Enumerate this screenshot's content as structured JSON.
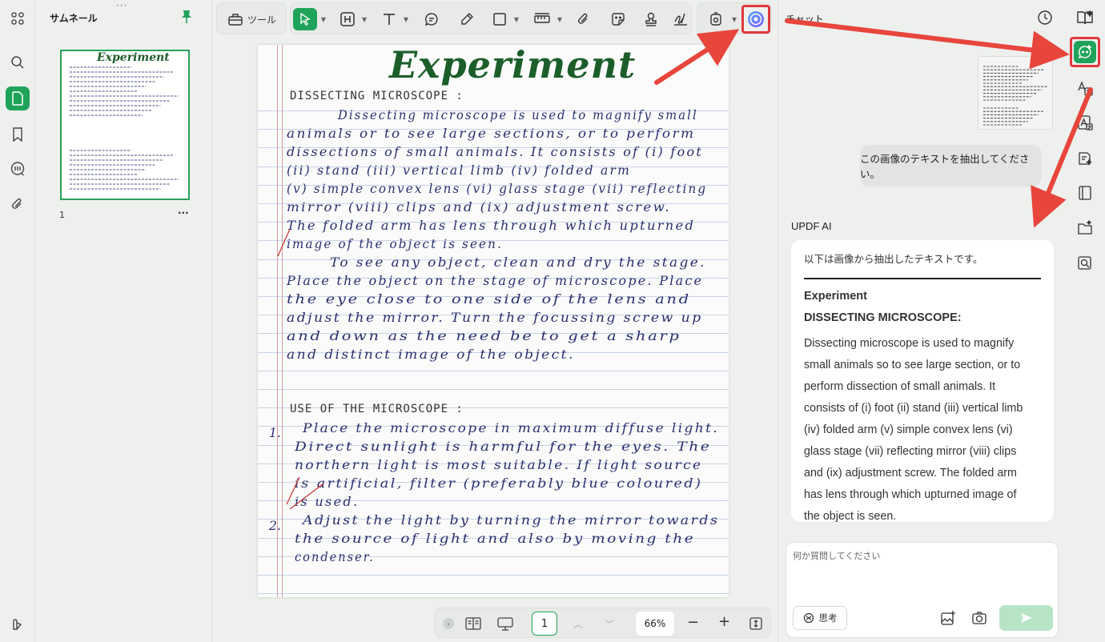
{
  "thumbnails": {
    "title": "サムネール",
    "page_number": "1",
    "more_label": "···",
    "thumb_title": "Experiment"
  },
  "toolbar": {
    "tool_label": "ツール"
  },
  "document": {
    "title": "Experiment",
    "lines": [
      {
        "text": "DISSECTING MICROSCOPE :",
        "print": true
      },
      {
        "text": "Dissecting microscope is used to magnify small"
      },
      {
        "text": "animals or to see large sections, or to perform"
      },
      {
        "text": "dissections of small animals. It consists of (i) foot"
      },
      {
        "text": "(ii) stand (iii) vertical limb (iv) folded arm"
      },
      {
        "text": "(v) simple convex lens (vi) glass stage (vii) reflecting"
      },
      {
        "text": "mirror (viii) clips and (ix) adjustment screw."
      },
      {
        "text": "The folded arm has lens through which upturned"
      },
      {
        "text": "image of the object is seen."
      },
      {
        "text": "To see any object, clean and dry the stage."
      },
      {
        "text": "Place the object on the stage of microscope. Place"
      },
      {
        "text": "the eye close to one side of the lens and"
      },
      {
        "text": "adjust the mirror. Turn the focussing screw up"
      },
      {
        "text": "and down as the need be to get a sharp"
      },
      {
        "text": "and distinct image of the object."
      },
      {
        "text": "USE OF THE MICROSCOPE :",
        "print": true
      },
      {
        "text": "Place the microscope in maximum diffuse light."
      },
      {
        "text": "Direct sunlight is harmful for the eyes. The"
      },
      {
        "text": "northern light is most suitable. If light source"
      },
      {
        "text": "is artificial, filter (preferably blue coloured)"
      },
      {
        "text": "is used."
      },
      {
        "text": "Adjust the light by turning the mirror towards"
      },
      {
        "text": "the source of light and also by moving the"
      },
      {
        "text": "condenser."
      }
    ],
    "margin_numbers": [
      "1.",
      "2."
    ]
  },
  "bottombar": {
    "page_value": "1",
    "zoom": "66%"
  },
  "chat": {
    "header": "チャット",
    "user_message": "この画像のテキストを抽出してください。",
    "ai_name": "UPDF AI",
    "ai_intro": "以下は画像から抽出したテキストです。",
    "ai_heading1": "Experiment",
    "ai_heading2": "DISSECTING MICROSCOPE:",
    "ai_lines": [
      "Dissecting microscope is used to magnify",
      "small animals so to see large section, or to",
      "perform dissection of small animals. It",
      "consists of (i) foot (ii) stand (iii) vertical limb",
      "(iv) folded arm (v) simple convex lens (vi)",
      "glass stage (vii) reflecting mirror (viii) clips",
      "and (ix) adjustment screw. The folded arm",
      "has lens through which upturned image of",
      "the object is seen."
    ],
    "input_placeholder": "何か質問してください",
    "think_label": "思考"
  },
  "colors": {
    "accent_green": "#1fa35a",
    "highlight_red": "#e0393b",
    "ink_blue": "#2a2f6e",
    "title_green": "#1b5e2a"
  },
  "icons": [
    "apps-icon",
    "search-icon",
    "page-icon",
    "bookmark-icon",
    "comment-icon",
    "attachment-icon",
    "pin-icon",
    "ai-assistant-icon",
    "chat-history-icon",
    "ai-chat-icon",
    "translate-icon",
    "ocr-icon",
    "summarize-icon",
    "read-icon",
    "folder-ai-icon",
    "search-ai-icon",
    "send-icon",
    "camera-icon",
    "image-add-icon"
  ]
}
